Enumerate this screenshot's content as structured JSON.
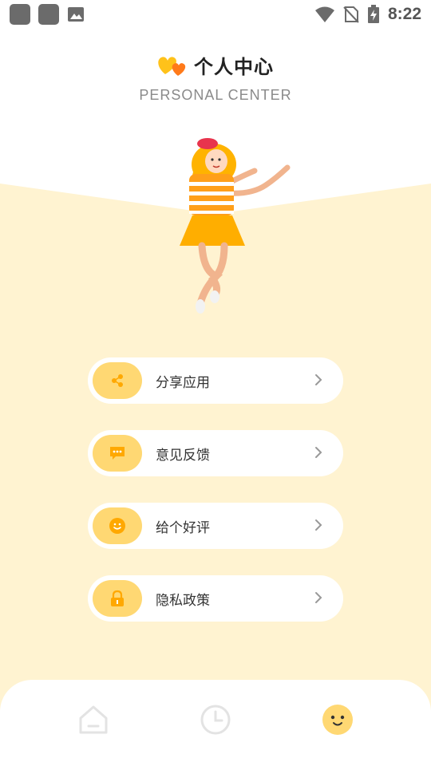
{
  "status_bar": {
    "time": "8:22"
  },
  "header": {
    "title": "个人中心",
    "subtitle": "PERSONAL CENTER"
  },
  "menu": {
    "items": [
      {
        "label": "分享应用",
        "icon": "share-icon"
      },
      {
        "label": "意见反馈",
        "icon": "chat-icon"
      },
      {
        "label": "给个好评",
        "icon": "smile-icon"
      },
      {
        "label": "隐私政策",
        "icon": "lock-icon"
      }
    ]
  },
  "bottom_nav": {
    "items": [
      {
        "icon": "home-icon",
        "active": false
      },
      {
        "icon": "clock-icon",
        "active": false
      },
      {
        "icon": "smiley-face-icon",
        "active": true
      }
    ]
  },
  "colors": {
    "accent": "#ffd873",
    "background_panel": "#fff3d1",
    "icon_inactive": "#e3e3e3",
    "icon_glyph": "#ffa800"
  }
}
